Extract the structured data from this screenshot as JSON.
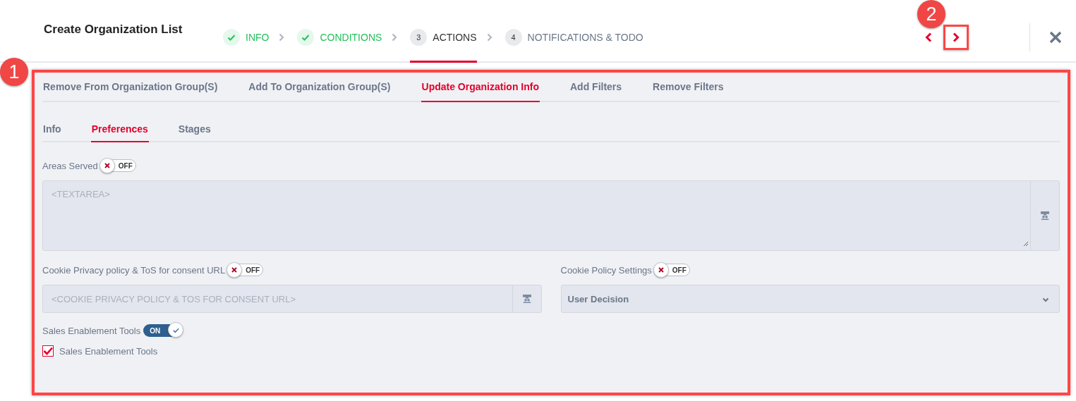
{
  "header": {
    "title": "Create Organization List",
    "steps": [
      {
        "label": "INFO",
        "done": true,
        "selected": false
      },
      {
        "label": "CONDITIONS",
        "done": true,
        "selected": false
      },
      {
        "number": "3",
        "label": "ACTIONS",
        "done": false,
        "selected": true
      },
      {
        "number": "4",
        "label": "NOTIFICATIONS & TODO",
        "done": false,
        "selected": false
      }
    ],
    "next_highlighted": true
  },
  "annotations": [
    {
      "label": "1"
    },
    {
      "label": "2"
    }
  ],
  "panel": {
    "highlighted": true,
    "action_tabs": [
      {
        "label": "Remove From Organization Group(S)",
        "selected": false
      },
      {
        "label": "Add To Organization Group(S)",
        "selected": false
      },
      {
        "label": "Update Organization Info",
        "selected": true
      },
      {
        "label": "Add Filters",
        "selected": false
      },
      {
        "label": "Remove Filters",
        "selected": false
      }
    ],
    "sub_tabs": [
      {
        "label": "Info",
        "selected": false
      },
      {
        "label": "Preferences",
        "selected": true
      },
      {
        "label": "Stages",
        "selected": false
      }
    ],
    "areas_served": {
      "label": "Areas Served",
      "toggle": {
        "on": false,
        "text": "OFF"
      },
      "placeholder": "<TEXTAREA>"
    },
    "cookie_url": {
      "label": "Cookie Privacy policy & ToS for consent URL",
      "toggle": {
        "on": false,
        "text": "OFF"
      },
      "placeholder": "<COOKIE PRIVACY POLICY & TOS FOR CONSENT URL>"
    },
    "cookie_policy": {
      "label": "Cookie Policy Settings",
      "toggle": {
        "on": false,
        "text": "OFF"
      },
      "value": "User Decision"
    },
    "sales_tools": {
      "label": "Sales Enablement Tools",
      "toggle": {
        "on": true,
        "text": "ON"
      }
    },
    "checkbox": {
      "label": "Sales Enablement Tools",
      "checked": true
    }
  }
}
